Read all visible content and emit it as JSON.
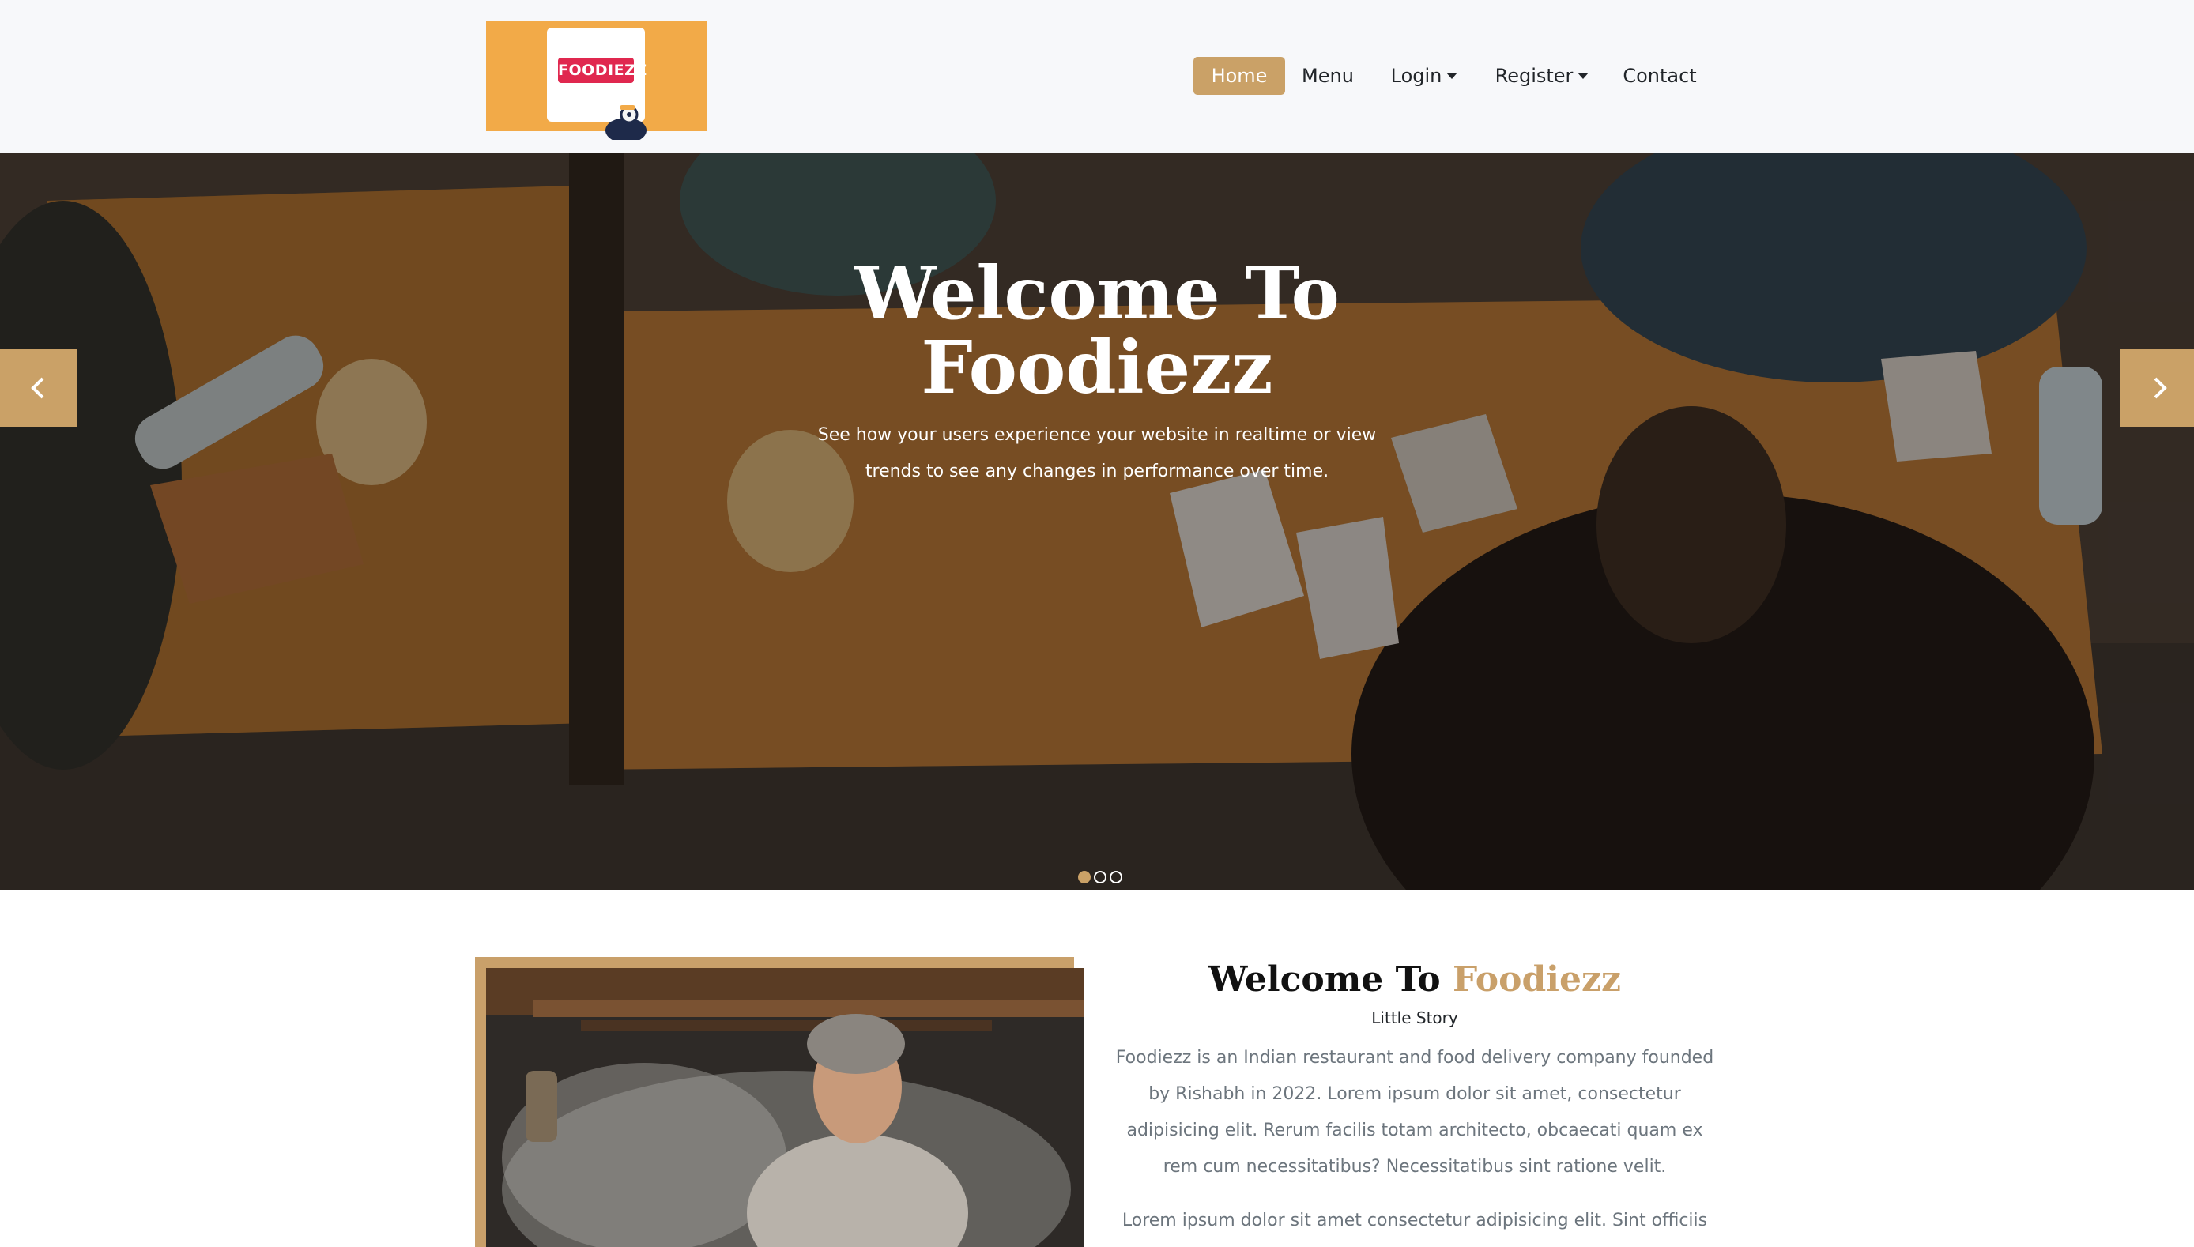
{
  "brand": {
    "logo_text": "FOODIEZZ",
    "colors": {
      "accent": "#caa167",
      "logo_bg": "#f2aa48",
      "logo_badge": "#e0284f"
    }
  },
  "nav": {
    "items": [
      {
        "label": "Home",
        "active": true
      },
      {
        "label": "Menu"
      },
      {
        "label": "Login",
        "dropdown": true
      },
      {
        "label": "Register",
        "dropdown": true
      },
      {
        "label": "Contact"
      }
    ]
  },
  "hero": {
    "title": "Welcome To Foodiezz",
    "subtitle": "See how your users experience your website in realtime or view trends to see any changes in performance over time.",
    "prev_icon": "chevron-left-icon",
    "next_icon": "chevron-right-icon",
    "slides": {
      "count": 3,
      "active": 1
    }
  },
  "about": {
    "title_prefix": "Welcome To",
    "title_accent": "Foodiezz",
    "subtitle": "Little Story",
    "paragraph1": "Foodiezz is an Indian restaurant and food delivery company founded by Rishabh in 2022. Lorem ipsum dolor sit amet, consectetur adipisicing elit. Rerum facilis totam architecto, obcaecati quam ex rem cum necessitatibus? Necessitatibus sint ratione velit.",
    "paragraph2": "Lorem ipsum dolor sit amet consectetur adipisicing elit. Sint officiis"
  }
}
